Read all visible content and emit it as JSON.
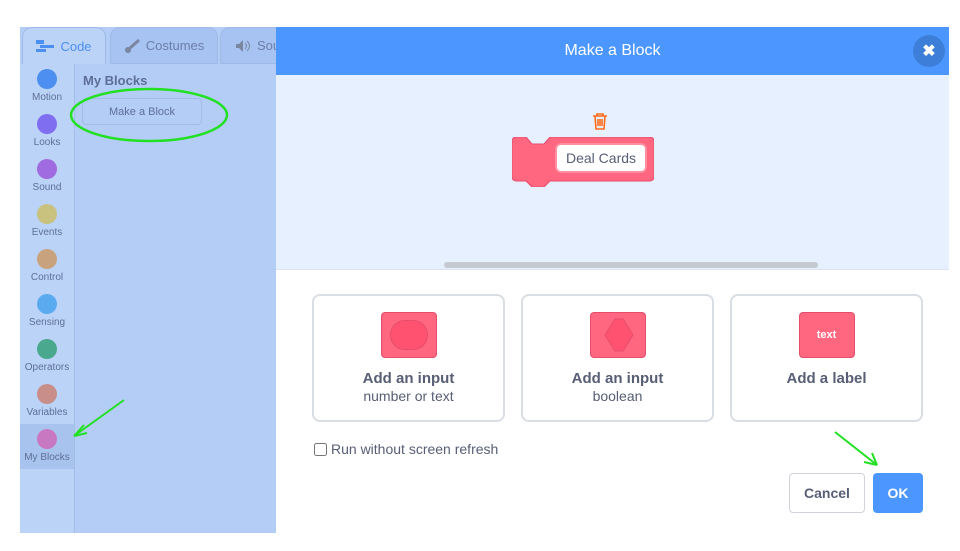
{
  "tabs": [
    {
      "label": "Code",
      "icon": "code-icon"
    },
    {
      "label": "Costumes",
      "icon": "brush-icon"
    },
    {
      "label": "Sou",
      "icon": "speaker-icon"
    }
  ],
  "categories": [
    {
      "label": "Motion",
      "color": "#4c8ff0"
    },
    {
      "label": "Looks",
      "color": "#7f6ff0"
    },
    {
      "label": "Sound",
      "color": "#a06ae0"
    },
    {
      "label": "Events",
      "color": "#c8c27e"
    },
    {
      "label": "Control",
      "color": "#c8a27c"
    },
    {
      "label": "Sensing",
      "color": "#5aaaf0"
    },
    {
      "label": "Operators",
      "color": "#4aa88e"
    },
    {
      "label": "Variables",
      "color": "#c88e8a"
    },
    {
      "label": "My Blocks",
      "color": "#c878c0"
    }
  ],
  "palette": {
    "title": "My Blocks",
    "make_block": "Make a Block"
  },
  "modal": {
    "title": "Make a Block",
    "block_name": "Deal Cards",
    "options": [
      {
        "title": "Add an input",
        "subtitle": "number or text",
        "icon": "number-input-icon"
      },
      {
        "title": "Add an input",
        "subtitle": "boolean",
        "icon": "boolean-input-icon"
      },
      {
        "title": "Add a label",
        "subtitle": "",
        "icon": "label-icon",
        "icon_text": "text"
      }
    ],
    "checkbox_label": "Run without screen refresh",
    "checkbox_checked": false,
    "cancel": "Cancel",
    "ok": "OK"
  },
  "colors": {
    "accent": "#4c97ff",
    "block": "#ff6680",
    "annotation": "#22e022"
  }
}
